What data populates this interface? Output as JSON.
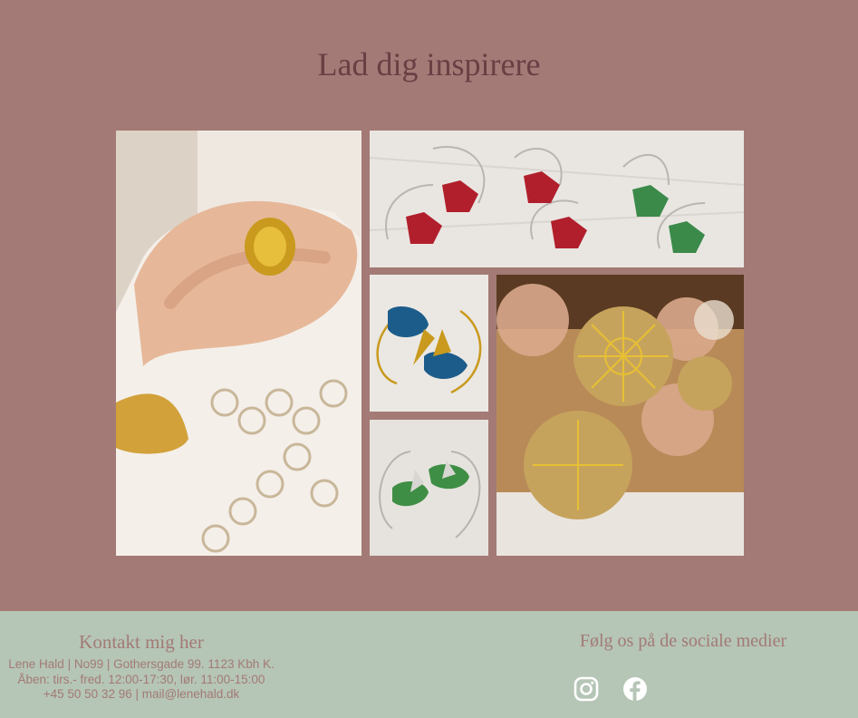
{
  "main": {
    "heading": "Lad dig inspirere",
    "gallery": [
      {
        "name": "ring-and-necklace-photo",
        "description_icon": "photo-icon"
      },
      {
        "name": "red-green-earrings-photo",
        "description_icon": "photo-icon"
      },
      {
        "name": "blue-earrings-photo",
        "description_icon": "photo-icon"
      },
      {
        "name": "green-earrings-photo",
        "description_icon": "photo-icon"
      },
      {
        "name": "mesh-flower-necklace-photo",
        "description_icon": "photo-icon"
      }
    ]
  },
  "footer": {
    "contact": {
      "title": "Kontakt mig her",
      "address": "Lene Hald | No99 | Gothersgade 99. 1123 Kbh K.",
      "hours": "Åben: tirs.- fred. 12:00-17:30, lør. 11:00-15:00",
      "phone_email": "+45 50 50 32 96 | mail@lenehald.dk"
    },
    "social": {
      "title": "Følg os på de sociale medier",
      "icons": [
        "instagram-icon",
        "facebook-icon"
      ]
    }
  },
  "colors": {
    "page_background": "#a37a75",
    "heading": "#6a3f44",
    "footer_background": "#b5c5b6",
    "footer_text": "#a37a75",
    "icon": "#ffffff"
  }
}
